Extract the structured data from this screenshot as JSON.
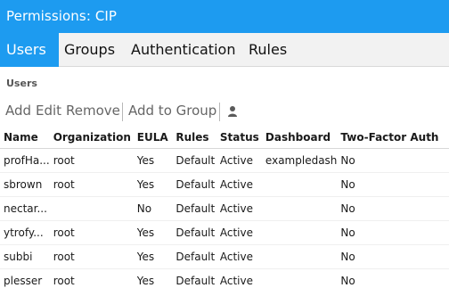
{
  "window": {
    "title": "Permissions: CIP"
  },
  "colors": {
    "accent": "#1d9bf0",
    "tabbar_bg": "#f2f2f2"
  },
  "tabs": [
    {
      "label": "Users",
      "active": true
    },
    {
      "label": "Groups",
      "active": false
    },
    {
      "label": "Authentication",
      "active": false
    },
    {
      "label": "Rules",
      "active": false
    }
  ],
  "section": {
    "title": "Users"
  },
  "toolbar": {
    "add_label": "Add",
    "edit_label": "Edit",
    "remove_label": "Remove",
    "add_to_group_label": "Add to Group",
    "user_icon": "user-icon"
  },
  "table": {
    "columns": [
      "Name",
      "Organization",
      "EULA",
      "Rules",
      "Status",
      "Dashboard",
      "Two-Factor Auth"
    ],
    "rows": [
      [
        "profHa...",
        "root",
        "Yes",
        "Default",
        "Active",
        "exampledash",
        "No"
      ],
      [
        "sbrown",
        "root",
        "Yes",
        "Default",
        "Active",
        "",
        "No"
      ],
      [
        "nectar...",
        "",
        "No",
        "Default",
        "Active",
        "",
        "No"
      ],
      [
        "ytrofy...",
        "root",
        "Yes",
        "Default",
        "Active",
        "",
        "No"
      ],
      [
        "subbi",
        "root",
        "Yes",
        "Default",
        "Active",
        "",
        "No"
      ],
      [
        "plesser",
        "root",
        "Yes",
        "Default",
        "Active",
        "",
        "No"
      ]
    ]
  }
}
